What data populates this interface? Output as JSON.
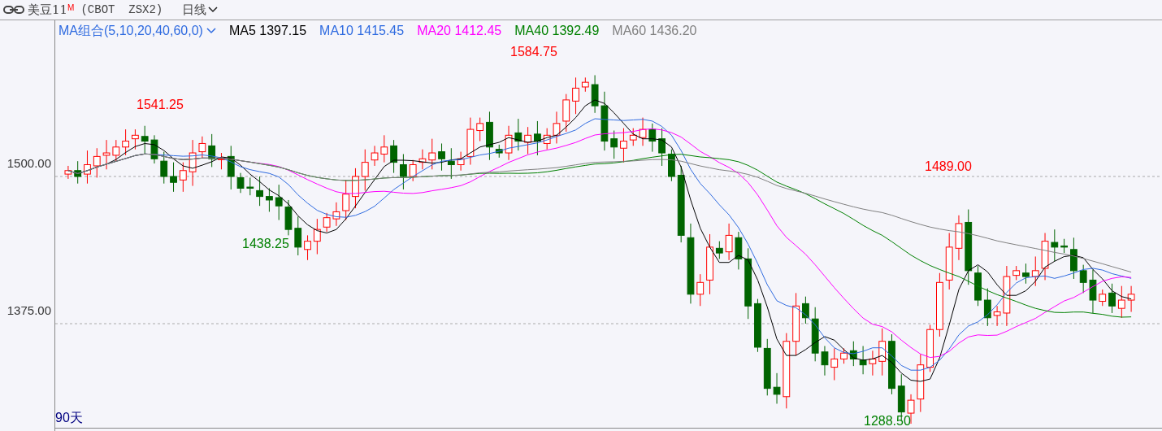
{
  "header": {
    "symbol": "美豆11",
    "badge": "M",
    "code": "(CBOT  ZSX2)",
    "period": "日线"
  },
  "ma_legend": {
    "selector": "MA组合(5,10,20,40,60,0)",
    "items": [
      {
        "label": "MA5",
        "value": "1397.15",
        "color": "#000000"
      },
      {
        "label": "MA10",
        "value": "1415.45",
        "color": "#2f6be0"
      },
      {
        "label": "MA20",
        "value": "1412.45",
        "color": "#ff00ff"
      },
      {
        "label": "MA40",
        "value": "1392.49",
        "color": "#008000"
      },
      {
        "label": "MA60",
        "value": "1436.20",
        "color": "#808080"
      }
    ]
  },
  "y_axis": {
    "labels": [
      "1500.00",
      "1375.00"
    ]
  },
  "annotations": [
    {
      "text": "1541.25",
      "kind": "high"
    },
    {
      "text": "1584.75",
      "kind": "high"
    },
    {
      "text": "1438.25",
      "kind": "low"
    },
    {
      "text": "1489.00",
      "kind": "high"
    },
    {
      "text": "1288.50",
      "kind": "low"
    }
  ],
  "footer": {
    "days": "90天"
  }
}
